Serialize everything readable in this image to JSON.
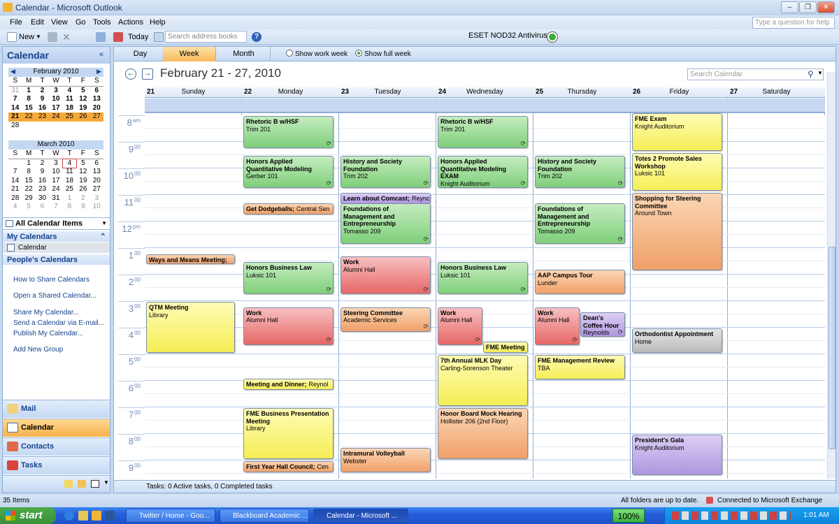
{
  "window": {
    "title": "Calendar - Microsoft Outlook"
  },
  "menu": [
    "File",
    "Edit",
    "View",
    "Go",
    "Tools",
    "Actions",
    "Help"
  ],
  "help_placeholder": "Type a question for help",
  "toolbar": {
    "new": "New",
    "today": "Today",
    "search_placeholder": "Search address books",
    "eset": "ESET NOD32 Antivirus"
  },
  "nav": {
    "title": "Calendar",
    "feb": {
      "title": "February 2010",
      "dow": [
        "S",
        "M",
        "T",
        "W",
        "T",
        "F",
        "S"
      ],
      "days": [
        "31",
        "1",
        "2",
        "3",
        "4",
        "5",
        "6",
        "7",
        "8",
        "9",
        "10",
        "11",
        "12",
        "13",
        "14",
        "15",
        "16",
        "17",
        "18",
        "19",
        "20",
        "21",
        "22",
        "23",
        "24",
        "25",
        "26",
        "27",
        "28"
      ]
    },
    "mar": {
      "title": "March 2010",
      "dow": [
        "S",
        "M",
        "T",
        "W",
        "T",
        "F",
        "S"
      ],
      "days": [
        "",
        "1",
        "2",
        "3",
        "4",
        "5",
        "6",
        "7",
        "8",
        "9",
        "10",
        "11",
        "12",
        "13",
        "14",
        "15",
        "16",
        "17",
        "18",
        "19",
        "20",
        "21",
        "22",
        "23",
        "24",
        "25",
        "26",
        "27",
        "28",
        "29",
        "30",
        "31",
        "1",
        "2",
        "3",
        "4",
        "5",
        "6",
        "7",
        "8",
        "9",
        "10"
      ]
    },
    "all_items": "All Calendar Items",
    "my_calendars": "My Calendars",
    "calendar_item": "Calendar",
    "peoples": "People's Calendars",
    "links": [
      "How to Share Calendars",
      "Open a Shared Calendar...",
      "Share My Calendar...",
      "Send a Calendar via E-mail...",
      "Publish My Calendar...",
      "Add New Group"
    ],
    "buttons": [
      "Mail",
      "Calendar",
      "Contacts",
      "Tasks"
    ]
  },
  "view": {
    "tabs": [
      "Day",
      "Week",
      "Month"
    ],
    "show_work_week": "Show work week",
    "show_full_week": "Show full week",
    "range": "February 21 - 27, 2010",
    "search_placeholder": "Search Calendar"
  },
  "days": [
    {
      "num": "21",
      "name": "Sunday"
    },
    {
      "num": "22",
      "name": "Monday"
    },
    {
      "num": "23",
      "name": "Tuesday"
    },
    {
      "num": "24",
      "name": "Wednesday"
    },
    {
      "num": "25",
      "name": "Thursday"
    },
    {
      "num": "26",
      "name": "Friday"
    },
    {
      "num": "27",
      "name": "Saturday"
    }
  ],
  "hours": [
    {
      "h": "8",
      "s": "am"
    },
    {
      "h": "9",
      "s": "00"
    },
    {
      "h": "10",
      "s": "00"
    },
    {
      "h": "11",
      "s": "00"
    },
    {
      "h": "12",
      "s": "pm"
    },
    {
      "h": "1",
      "s": "00"
    },
    {
      "h": "2",
      "s": "00"
    },
    {
      "h": "3",
      "s": "00"
    },
    {
      "h": "4",
      "s": "00"
    },
    {
      "h": "5",
      "s": "00"
    },
    {
      "h": "6",
      "s": "00"
    },
    {
      "h": "7",
      "s": "00"
    },
    {
      "h": "8",
      "s": "00"
    },
    {
      "h": "9",
      "s": "00"
    }
  ],
  "events": {
    "sun_ways": {
      "t": "Ways and Means Meeting;"
    },
    "sun_qtm": {
      "t": "QTM Meeting",
      "l": "Library"
    },
    "mon_rhet": {
      "t": "Rhetoric B w/HSF",
      "l": "Trim 201"
    },
    "mon_honors": {
      "t": "Honors Applied Quantitative Modeling",
      "l": "Gerber 101"
    },
    "mon_dodge": {
      "t": "Get Dodgeballs;",
      "l": "Central Sen"
    },
    "mon_hbl": {
      "t": "Honors Business Law",
      "l": "Luksic 101"
    },
    "mon_work": {
      "t": "Work",
      "l": "Alumni Hall"
    },
    "mon_meet": {
      "t": "Meeting and Dinner;",
      "l": "Reynol"
    },
    "mon_fmebp": {
      "t": "FME Business Presentation Meeting",
      "l": "Library"
    },
    "mon_fyhc": {
      "t": "First Year Hall Council;",
      "l": "Cen"
    },
    "tue_hist": {
      "t": "History and Society Foundation",
      "l": "Trim 202"
    },
    "tue_comcast": {
      "t": "Learn about Comcast;",
      "l": "Reync"
    },
    "tue_found": {
      "t": "Foundations of Management and Entrepreneurship",
      "l": "Tomasso 209"
    },
    "tue_work": {
      "t": "Work",
      "l": "Alumni Hall"
    },
    "tue_steer": {
      "t": "Steering Committee",
      "l": "Academic Services"
    },
    "tue_volley": {
      "t": "Intramural Volleyball",
      "l": "Webster"
    },
    "wed_rhet": {
      "t": "Rhetoric B w/HSF",
      "l": "Trim 201"
    },
    "wed_honors": {
      "t": "Honors Applied Quantitative Modeling EXAM",
      "l": "Knight Auditorium"
    },
    "wed_hbl": {
      "t": "Honors Business Law",
      "l": "Luksic 101"
    },
    "wed_work": {
      "t": "Work",
      "l": "Alumni Hall"
    },
    "wed_fme": {
      "t": "FME Meeting"
    },
    "wed_mlk": {
      "t": "7th Annual MLK Day",
      "l": "Carling-Sorenson Theater"
    },
    "wed_board": {
      "t": "Honor Board Mock Hearing",
      "l": "Hollister 206 (2nd Floor)"
    },
    "thu_hist": {
      "t": "History and Society Foundation",
      "l": "Trim 202"
    },
    "thu_found": {
      "t": "Foundations of Management and Entrepreneurship",
      "l": "Tomasso 209"
    },
    "thu_aap": {
      "t": "AAP Campus Tour",
      "l": "Lunder"
    },
    "thu_work": {
      "t": "Work",
      "l": "Alumni Hall"
    },
    "thu_dean": {
      "t": "Dean's Coffee Hour",
      "l": "Reynolds"
    },
    "thu_fmemr": {
      "t": "FME Management Review",
      "l": "TBA"
    },
    "fri_exam": {
      "t": "FME Exam",
      "l": "Knight Auditorium"
    },
    "fri_totes": {
      "t": "Totes 2 Promote Sales Workshop",
      "l": "Luksic 101"
    },
    "fri_shop": {
      "t": "Shopping for Steering Committee",
      "l": "Around Town"
    },
    "fri_ortho": {
      "t": "Orthodontist Appointment",
      "l": "Home"
    },
    "fri_gala": {
      "t": "President's Gala",
      "l": "Knight Auditorium"
    }
  },
  "tasks_bar": "Tasks: 0 Active tasks, 0 Completed tasks",
  "status": {
    "items": "35 Items",
    "folders": "All folders are up to date.",
    "exchange": "Connected to Microsoft Exchange"
  },
  "taskbar": {
    "start": "start",
    "windows": [
      "Twitter / Home - Goo...",
      "Blackboard Academic ...",
      "Calendar - Microsoft ..."
    ],
    "zoom": "100%",
    "clock": "1:01 AM"
  }
}
